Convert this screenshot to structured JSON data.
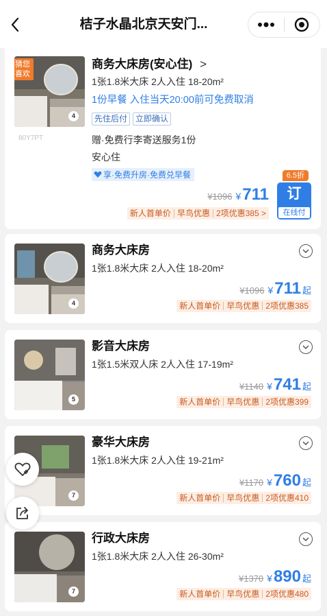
{
  "header": {
    "title": "桔子水晶北京天安门..."
  },
  "featured": {
    "badge": "猜您\n喜欢",
    "photo_count": "4",
    "code": "80Y7PT",
    "name": "商务大床房(安心住)",
    "arrow": ">",
    "spec": "1张1.8米大床  2人入住  18-20m²",
    "policy": "1份早餐  入住当天20:00前可免费取消",
    "tags": [
      "先住后付",
      "立即确认"
    ],
    "gift": "赠·免费行李寄送服务1份",
    "safety": "安心住",
    "member_benefit": "享·免费升房·免费兑早餐",
    "original_price": "¥1096",
    "currency": "¥",
    "price": "711",
    "promos": [
      "新人首单价",
      "早鸟优惠",
      "2项优惠385 >"
    ],
    "discount": "6.5折",
    "book_label": "订",
    "book_sub": "在线付"
  },
  "rooms": [
    {
      "name": "商务大床房",
      "spec": "1张1.8米大床  2人入住  18-20m²",
      "photo_count": "4",
      "original_price": "¥1096",
      "currency": "¥",
      "price": "711",
      "suffix": "起",
      "promos": [
        "新人首单价",
        "早鸟优惠",
        "2项优惠385"
      ]
    },
    {
      "name": "影音大床房",
      "spec": "1张1.5米双人床  2人入住  17-19m²",
      "photo_count": "5",
      "original_price": "¥1140",
      "currency": "¥",
      "price": "741",
      "suffix": "起",
      "promos": [
        "新人首单价",
        "早鸟优惠",
        "2项优惠399"
      ]
    },
    {
      "name": "豪华大床房",
      "spec": "1张1.8米大床  2人入住  19-21m²",
      "photo_count": "7",
      "original_price": "¥1170",
      "currency": "¥",
      "price": "760",
      "suffix": "起",
      "promos": [
        "新人首单价",
        "早鸟优惠",
        "2项优惠410"
      ]
    },
    {
      "name": "行政大床房",
      "spec": "1张1.8米大床  2人入住  26-30m²",
      "photo_count": "7",
      "original_price": "¥1370",
      "currency": "¥",
      "price": "890",
      "suffix": "起",
      "promos": [
        "新人首单价",
        "早鸟优惠",
        "2项优惠480"
      ]
    }
  ],
  "colors": {
    "accent_blue": "#2f7ee6",
    "promo_orange": "#c85a24",
    "badge_orange": "#f07b2b"
  },
  "icons": [
    "back-arrow-icon",
    "more-icon",
    "close-target-icon",
    "chevron-down-icon",
    "heart-icon",
    "share-icon"
  ]
}
